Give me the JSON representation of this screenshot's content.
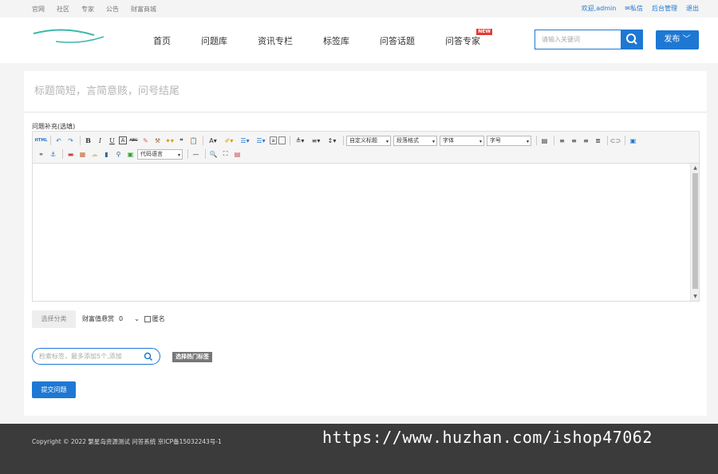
{
  "topbar": {
    "links": [
      "官网",
      "社区",
      "专家",
      "公告",
      "财富商城"
    ],
    "welcome": "欢迎,admin",
    "messages": "私信",
    "admin": "后台管理",
    "logout": "退出"
  },
  "nav": {
    "items": [
      "首页",
      "问题库",
      "资讯专栏",
      "标签库",
      "问答话题",
      "问答专家"
    ],
    "new_badge": "NEW"
  },
  "search": {
    "placeholder": "请输入关键词"
  },
  "publish": {
    "label": "发布"
  },
  "form": {
    "title_placeholder": "标题简短，言简意赅，问号结尾",
    "supplement_label": "问题补充(选填)",
    "editor": {
      "custom_title": "自定义标题",
      "paragraph_format": "段落格式",
      "font": "字体",
      "font_size": "字号",
      "code_language": "代码语言"
    },
    "category_button": "选择分类",
    "reward_label": "财富值悬赏",
    "reward_value": "0",
    "anonymous_label": "匿名",
    "tag_placeholder": "检索标签，最多添加5个,添加",
    "hot_tags_button": "选择热门标签",
    "submit_button": "提交问题"
  },
  "footer": {
    "copyright": "Copyright © 2022 繁星岛资源测试 问答系统 京ICP备15032243号-1"
  },
  "watermark": "https://www.huzhan.com/ishop47062",
  "colors": {
    "accent": "#1e78d3",
    "footer_bg": "#3b3b3b",
    "badge": "#e53935"
  }
}
